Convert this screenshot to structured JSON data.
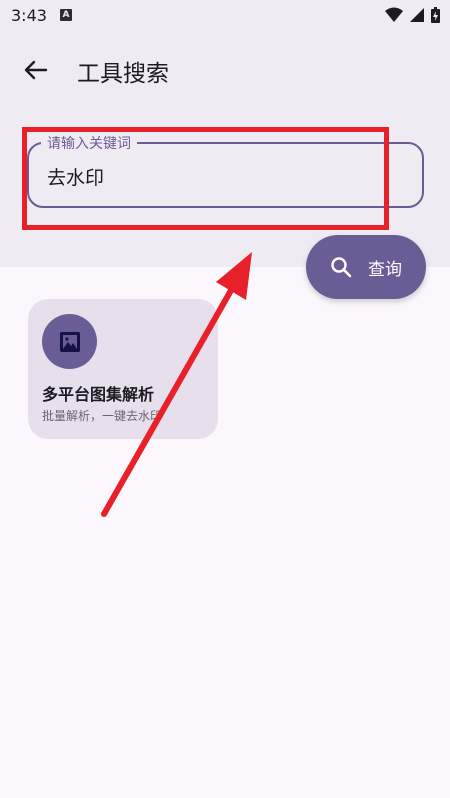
{
  "status": {
    "time": "3:43",
    "notif_letter": "A"
  },
  "header": {
    "title": "工具搜索"
  },
  "search": {
    "label": "请输入关键词",
    "value": "去水印"
  },
  "query_button": {
    "label": "查询"
  },
  "results": [
    {
      "title": "多平台图集解析",
      "desc": "批量解析，一键去水印"
    }
  ],
  "colors": {
    "accent": "#6a5c95",
    "highlight": "#e8202a",
    "surface": "#efebf2",
    "background": "#fcf7fd"
  }
}
